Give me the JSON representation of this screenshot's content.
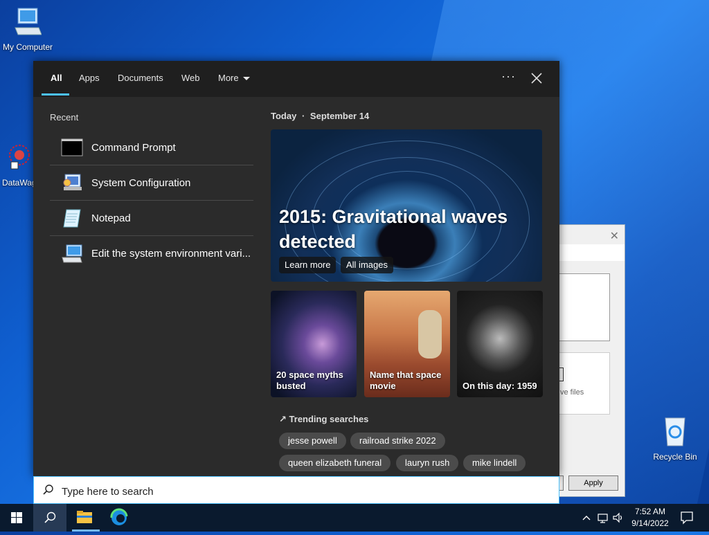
{
  "desktop": {
    "icons": [
      {
        "label": "My Computer"
      },
      {
        "label": "DataWag"
      },
      {
        "label": "Recycle Bin"
      }
    ]
  },
  "background_dialog": {
    "files_text": "ve files",
    "apply_label": "Apply"
  },
  "search_panel": {
    "tabs": [
      {
        "label": "All"
      },
      {
        "label": "Apps"
      },
      {
        "label": "Documents"
      },
      {
        "label": "Web"
      },
      {
        "label": "More"
      }
    ],
    "recent": {
      "title": "Recent",
      "items": [
        {
          "label": "Command Prompt",
          "icon": "command-prompt-icon"
        },
        {
          "label": "System Configuration",
          "icon": "system-configuration-icon"
        },
        {
          "label": "Notepad",
          "icon": "notepad-icon"
        },
        {
          "label": "Edit the system environment vari...",
          "icon": "system-properties-icon"
        }
      ]
    },
    "today": {
      "label": "Today",
      "separator": "·",
      "date": "September 14"
    },
    "hero": {
      "title": "2015: Gravitational waves detected",
      "learn_more": "Learn more",
      "all_images": "All images"
    },
    "cards": [
      {
        "caption": "20 space myths busted"
      },
      {
        "caption": "Name that space movie"
      },
      {
        "caption": "On this day: 1959"
      }
    ],
    "trending": {
      "title": "Trending searches",
      "items": [
        "jesse powell",
        "railroad strike 2022",
        "queen elizabeth funeral",
        "lauryn rush",
        "mike lindell"
      ]
    }
  },
  "search_box": {
    "placeholder": "Type here to search"
  },
  "taskbar": {
    "time": "7:52 AM",
    "date": "9/14/2022"
  },
  "colors": {
    "accent": "#4cc2ff",
    "panel_bg": "#2b2b2b",
    "taskbar_bg": "#0a1a2e"
  }
}
